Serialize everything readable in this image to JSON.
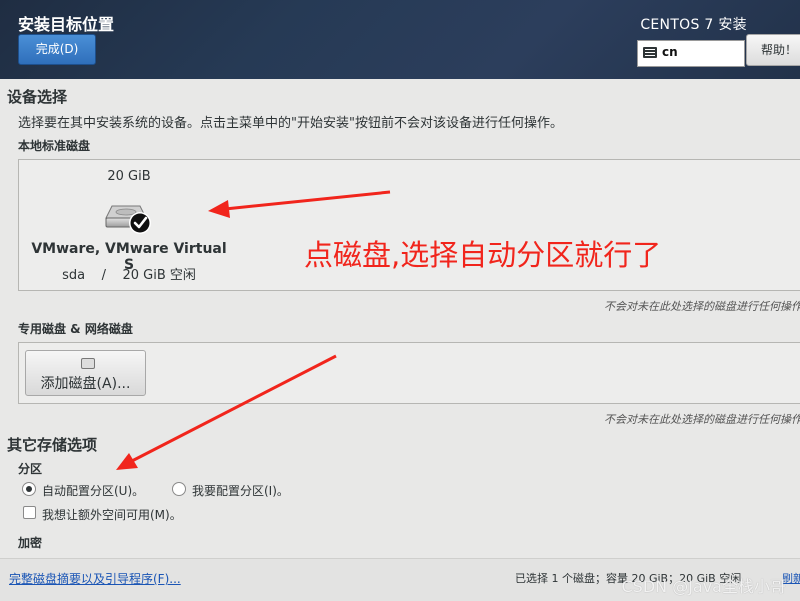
{
  "header": {
    "title": "安装目标位置",
    "done_button": "完成(D)",
    "product": "CENTOS 7 安装",
    "keyboard_layout": "cn",
    "help_button": "帮助！"
  },
  "device_selection": {
    "heading": "设备选择",
    "description": "选择要在其中安装系统的设备。点击主菜单中的\"开始安装\"按钮前不会对该设备进行任何操作。",
    "local_disks_label": "本地标准磁盘",
    "disk": {
      "size": "20 GiB",
      "name": "VMware, VMware Virtual S",
      "info": "sda    /    20 GiB 空闲"
    },
    "note_local": "不会对未在此处选择的磁盘进行任何操作",
    "special_disks_label": "专用磁盘 & 网络磁盘",
    "add_disk_button": "添加磁盘(A)...",
    "note_special": "不会对未在此处选择的磁盘进行任何操作"
  },
  "other_storage": {
    "heading": "其它存储选项",
    "partition_label": "分区",
    "auto_partition": "自动配置分区(U)。",
    "manual_partition": "我要配置分区(I)。",
    "auto_selected": true,
    "extra_space": "我想让额外空间可用(M)。",
    "encryption_label": "加密"
  },
  "footer": {
    "summary_link": "完整磁盘摘要以及引导程序(F)...",
    "status": "已选择 1 个磁盘；容量 20 GiB；20 GiB 空闲",
    "refresh_link": "刷新"
  },
  "annotation": {
    "text": "点磁盘,选择自动分区就行了",
    "color": "#f1251c"
  },
  "watermark": "CSDN @Java全栈小哥",
  "colors": {
    "header_bg": "#263a55",
    "accent_button": "#2f6fbb",
    "link": "#1a55b5"
  }
}
